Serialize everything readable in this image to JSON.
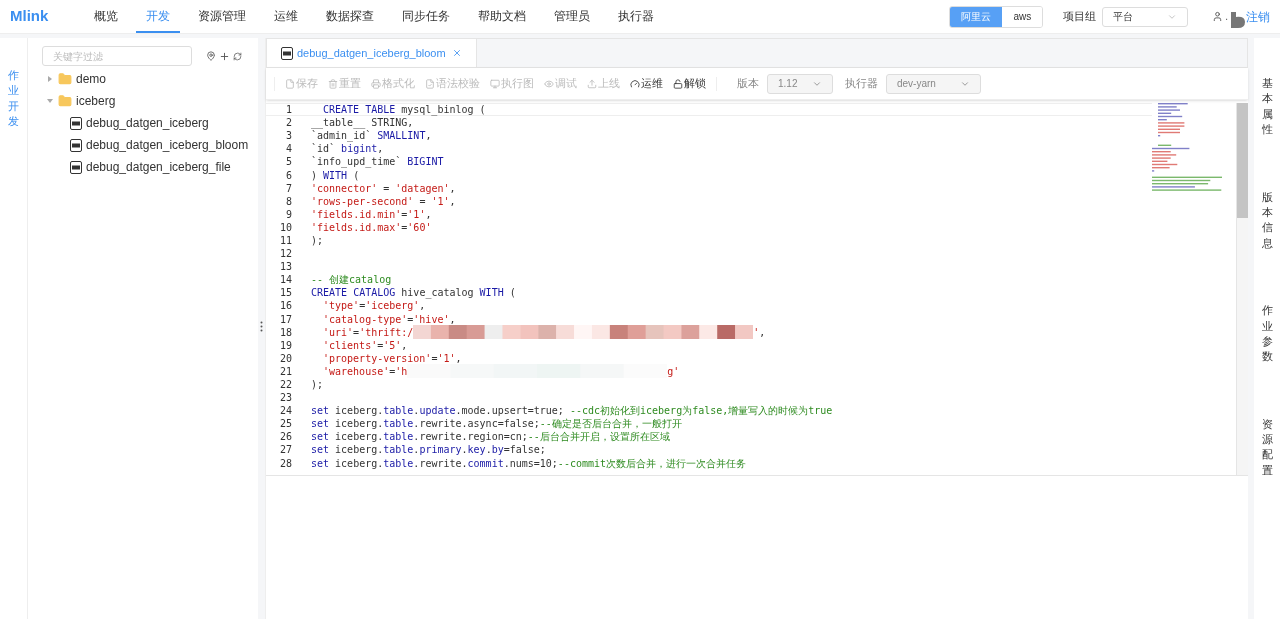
{
  "brand": "Mlink",
  "nav": [
    {
      "label": "概览",
      "selected": false
    },
    {
      "label": "开发",
      "selected": true
    },
    {
      "label": "资源管理",
      "selected": false
    },
    {
      "label": "运维",
      "selected": false
    },
    {
      "label": "数据探查",
      "selected": false
    },
    {
      "label": "同步任务",
      "selected": false
    },
    {
      "label": "帮助文档",
      "selected": false
    },
    {
      "label": "管理员",
      "selected": false
    },
    {
      "label": "执行器",
      "selected": false
    }
  ],
  "clouds": [
    {
      "label": "阿里云",
      "selected": true
    },
    {
      "label": "aws",
      "selected": false
    }
  ],
  "project_group": {
    "label": "项目组",
    "value": "平台"
  },
  "user": {
    "name": ".",
    "logout": "注销"
  },
  "left_tabs": [
    {
      "label": "作业开发",
      "selected": true
    }
  ],
  "tree": {
    "placeholder": "关键字过滤",
    "items": [
      {
        "label": "demo",
        "kind": "folder",
        "expanded": false
      },
      {
        "label": "iceberg",
        "kind": "folder",
        "expanded": true,
        "children": [
          {
            "label": "debug_datgen_iceberg",
            "kind": "file"
          },
          {
            "label": "debug_datgen_iceberg_bloom",
            "kind": "file"
          },
          {
            "label": "debug_datgen_iceberg_file",
            "kind": "file"
          }
        ]
      }
    ]
  },
  "editor_tabs": [
    {
      "label": "debug_datgen_iceberg_bloom",
      "selected": true
    }
  ],
  "toolbar": [
    {
      "label": "保存",
      "kind": "save",
      "disabled": true
    },
    {
      "label": "重置",
      "kind": "reset",
      "disabled": true
    },
    {
      "label": "格式化",
      "kind": "format",
      "disabled": true
    },
    {
      "label": "语法校验",
      "kind": "check",
      "disabled": true
    },
    {
      "label": "执行图",
      "kind": "graph",
      "disabled": true
    },
    {
      "label": "调试",
      "kind": "debug",
      "disabled": true
    },
    {
      "label": "上线",
      "kind": "upload",
      "disabled": true
    },
    {
      "label": "运维",
      "kind": "ops",
      "disabled": false
    },
    {
      "label": "解锁",
      "kind": "unlock",
      "disabled": false
    }
  ],
  "version": {
    "label": "版本",
    "value": "1.12",
    "disabled": true
  },
  "executor": {
    "label": "执行器",
    "value": "dev-yarn",
    "disabled": true
  },
  "code": [
    {
      "n": "1",
      "indented": true,
      "tokens": [
        {
          "kind": "keyword",
          "text": "CREATE TABLE"
        },
        {
          "kind": "plain",
          "text": " mysql_binlog ("
        }
      ]
    },
    {
      "n": "2",
      "tokens": [
        {
          "kind": "plain",
          "text": "__table__ STRING,"
        }
      ]
    },
    {
      "n": "3",
      "tokens": [
        {
          "kind": "plain",
          "text": "`admin_id` "
        },
        {
          "kind": "keyword",
          "text": "SMALLINT"
        },
        {
          "kind": "plain",
          "text": ","
        }
      ]
    },
    {
      "n": "4",
      "tokens": [
        {
          "kind": "plain",
          "text": "`id` "
        },
        {
          "kind": "keyword",
          "text": "bigint"
        },
        {
          "kind": "plain",
          "text": ","
        }
      ]
    },
    {
      "n": "5",
      "tokens": [
        {
          "kind": "plain",
          "text": "`info_upd_time` "
        },
        {
          "kind": "keyword",
          "text": "BIGINT"
        }
      ]
    },
    {
      "n": "6",
      "tokens": [
        {
          "kind": "plain",
          "text": ") "
        },
        {
          "kind": "keyword",
          "text": "WITH"
        },
        {
          "kind": "plain",
          "text": " ("
        }
      ]
    },
    {
      "n": "7",
      "tokens": [
        {
          "kind": "string",
          "text": "'connector'"
        },
        {
          "kind": "plain",
          "text": " = "
        },
        {
          "kind": "string",
          "text": "'datagen'"
        },
        {
          "kind": "plain",
          "text": ","
        }
      ]
    },
    {
      "n": "8",
      "tokens": [
        {
          "kind": "string",
          "text": "'rows-per-second'"
        },
        {
          "kind": "plain",
          "text": " = "
        },
        {
          "kind": "string",
          "text": "'1'"
        },
        {
          "kind": "plain",
          "text": ","
        }
      ]
    },
    {
      "n": "9",
      "tokens": [
        {
          "kind": "string",
          "text": "'fields.id.min'"
        },
        {
          "kind": "plain",
          "text": "="
        },
        {
          "kind": "string",
          "text": "'1'"
        },
        {
          "kind": "plain",
          "text": ","
        }
      ]
    },
    {
      "n": "10",
      "tokens": [
        {
          "kind": "string",
          "text": "'fields.id.max'"
        },
        {
          "kind": "plain",
          "text": "="
        },
        {
          "kind": "string",
          "text": "'60'"
        }
      ]
    },
    {
      "n": "11",
      "tokens": [
        {
          "kind": "plain",
          "text": ");"
        }
      ]
    },
    {
      "n": "12"
    },
    {
      "n": "13"
    },
    {
      "n": "14",
      "tokens": [
        {
          "kind": "comment",
          "text": "-- 创建catalog"
        }
      ]
    },
    {
      "n": "15",
      "tokens": [
        {
          "kind": "keyword",
          "text": "CREATE CATALOG"
        },
        {
          "kind": "plain",
          "text": " hive_catalog "
        },
        {
          "kind": "keyword",
          "text": "WITH"
        },
        {
          "kind": "plain",
          "text": " ("
        }
      ]
    },
    {
      "n": "16",
      "indented": true,
      "tokens": [
        {
          "kind": "string",
          "text": "'type'"
        },
        {
          "kind": "plain",
          "text": "="
        },
        {
          "kind": "string",
          "text": "'iceberg'"
        },
        {
          "kind": "plain",
          "text": ","
        }
      ]
    },
    {
      "n": "17",
      "indented": true,
      "tokens": [
        {
          "kind": "string",
          "text": "'catalog-type'"
        },
        {
          "kind": "plain",
          "text": "="
        },
        {
          "kind": "string",
          "text": "'hive'"
        },
        {
          "kind": "plain",
          "text": ","
        }
      ]
    },
    {
      "n": "18",
      "indented": true,
      "tokens": [
        {
          "kind": "string",
          "text": "'uri'"
        },
        {
          "kind": "plain",
          "text": "="
        },
        {
          "kind": "string",
          "text": "'thrift:/"
        },
        {
          "kind": "redacted",
          "strong": true
        },
        {
          "kind": "string",
          "text": "'"
        },
        {
          "kind": "plain",
          "text": ","
        }
      ]
    },
    {
      "n": "19",
      "indented": true,
      "tokens": [
        {
          "kind": "string",
          "text": "'clients'"
        },
        {
          "kind": "plain",
          "text": "="
        },
        {
          "kind": "string",
          "text": "'5'"
        },
        {
          "kind": "plain",
          "text": ","
        }
      ]
    },
    {
      "n": "20",
      "indented": true,
      "tokens": [
        {
          "kind": "string",
          "text": "'property-version'"
        },
        {
          "kind": "plain",
          "text": "="
        },
        {
          "kind": "string",
          "text": "'1'"
        },
        {
          "kind": "plain",
          "text": ","
        }
      ]
    },
    {
      "n": "21",
      "indented": true,
      "tokens": [
        {
          "kind": "string",
          "text": "'warehouse'"
        },
        {
          "kind": "plain",
          "text": "="
        },
        {
          "kind": "string",
          "text": "'h"
        },
        {
          "kind": "redacted",
          "strong": false
        },
        {
          "kind": "string",
          "text": "g'"
        }
      ]
    },
    {
      "n": "22",
      "tokens": [
        {
          "kind": "plain",
          "text": ");"
        }
      ]
    },
    {
      "n": "23"
    },
    {
      "n": "24",
      "tokens": [
        {
          "kind": "keyword",
          "text": "set"
        },
        {
          "kind": "plain",
          "text": " iceberg."
        },
        {
          "kind": "keyword",
          "text": "table"
        },
        {
          "kind": "plain",
          "text": "."
        },
        {
          "kind": "keyword",
          "text": "update"
        },
        {
          "kind": "plain",
          "text": ".mode.upsert=true; "
        },
        {
          "kind": "comment",
          "text": "--cdc初始化到iceberg为false,增量写入的时候为true"
        }
      ]
    },
    {
      "n": "25",
      "tokens": [
        {
          "kind": "keyword",
          "text": "set"
        },
        {
          "kind": "plain",
          "text": " iceberg."
        },
        {
          "kind": "keyword",
          "text": "table"
        },
        {
          "kind": "plain",
          "text": ".rewrite.async=false;"
        },
        {
          "kind": "comment",
          "text": "--确定是否后台合并，一般打开"
        }
      ]
    },
    {
      "n": "26",
      "tokens": [
        {
          "kind": "keyword",
          "text": "set"
        },
        {
          "kind": "plain",
          "text": " iceberg."
        },
        {
          "kind": "keyword",
          "text": "table"
        },
        {
          "kind": "plain",
          "text": ".rewrite.region=cn;"
        },
        {
          "kind": "comment",
          "text": "--后台合并开启，设置所在区域"
        }
      ]
    },
    {
      "n": "27",
      "tokens": [
        {
          "kind": "keyword",
          "text": "set"
        },
        {
          "kind": "plain",
          "text": " iceberg."
        },
        {
          "kind": "keyword",
          "text": "table"
        },
        {
          "kind": "plain",
          "text": "."
        },
        {
          "kind": "keyword",
          "text": "primary"
        },
        {
          "kind": "plain",
          "text": "."
        },
        {
          "kind": "keyword",
          "text": "key"
        },
        {
          "kind": "plain",
          "text": "."
        },
        {
          "kind": "keyword",
          "text": "by"
        },
        {
          "kind": "plain",
          "text": "=false;"
        }
      ]
    },
    {
      "n": "28",
      "tokens": [
        {
          "kind": "keyword",
          "text": "set"
        },
        {
          "kind": "plain",
          "text": " iceberg."
        },
        {
          "kind": "keyword",
          "text": "table"
        },
        {
          "kind": "plain",
          "text": ".rewrite."
        },
        {
          "kind": "keyword",
          "text": "commit"
        },
        {
          "kind": "plain",
          "text": ".nums=10;"
        },
        {
          "kind": "comment",
          "text": "--commit次数后合并，进行一次合并任务"
        }
      ]
    }
  ],
  "right_tabs": [
    {
      "label": "基本属性",
      "selected": false
    },
    {
      "label": "版本信息",
      "selected": false
    },
    {
      "label": "作业参数",
      "selected": false
    },
    {
      "label": "资源配置",
      "selected": false
    }
  ]
}
